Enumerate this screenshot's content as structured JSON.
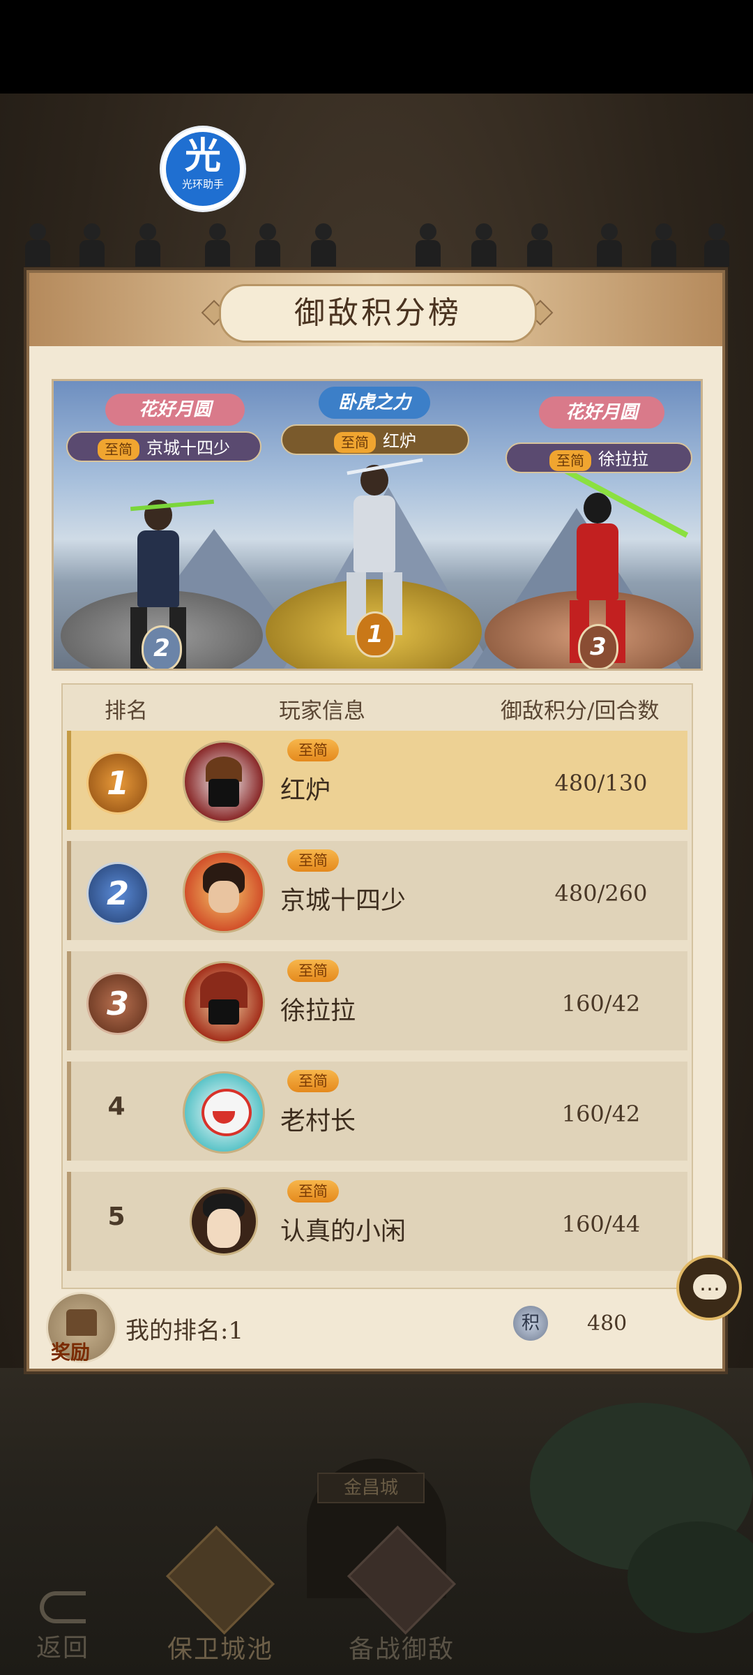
{
  "helper_badge": {
    "glyph": "光",
    "label": "光环助手"
  },
  "panel": {
    "title": "御敌积分榜"
  },
  "podium": [
    {
      "rank": "2",
      "event_tag": "花好月圆",
      "vip": "至简",
      "name": "京城十四少"
    },
    {
      "rank": "1",
      "event_tag": "卧虎之力",
      "vip": "至简",
      "name": "红炉"
    },
    {
      "rank": "3",
      "event_tag": "花好月圆",
      "vip": "至简",
      "name": "徐拉拉"
    }
  ],
  "table": {
    "headers": {
      "rank": "排名",
      "player": "玩家信息",
      "score": "御敌积分/回合数"
    },
    "rows": [
      {
        "rank": "1",
        "vip": "至简",
        "name": "红炉",
        "score": "480/130"
      },
      {
        "rank": "2",
        "vip": "至简",
        "name": "京城十四少",
        "score": "480/260"
      },
      {
        "rank": "3",
        "vip": "至简",
        "name": "徐拉拉",
        "score": "160/42"
      },
      {
        "rank": "4",
        "vip": "至简",
        "name": "老村长",
        "score": "160/42"
      },
      {
        "rank": "5",
        "vip": "至简",
        "name": "认真的小闲",
        "score": "160/44"
      }
    ]
  },
  "footer": {
    "reward_label": "奖励",
    "my_rank": "我的排名:1",
    "score_icon_glyph": "积",
    "my_score": "480"
  },
  "scene": {
    "gate_plaque": "金昌城"
  },
  "nav": {
    "back": "返回",
    "defend": "保卫城池",
    "prepare": "备战御敌"
  },
  "colors": {
    "gold": "#edd194",
    "bronze": "#a4613c",
    "silver": "#8ea0b8",
    "accent": "#e4891d"
  }
}
